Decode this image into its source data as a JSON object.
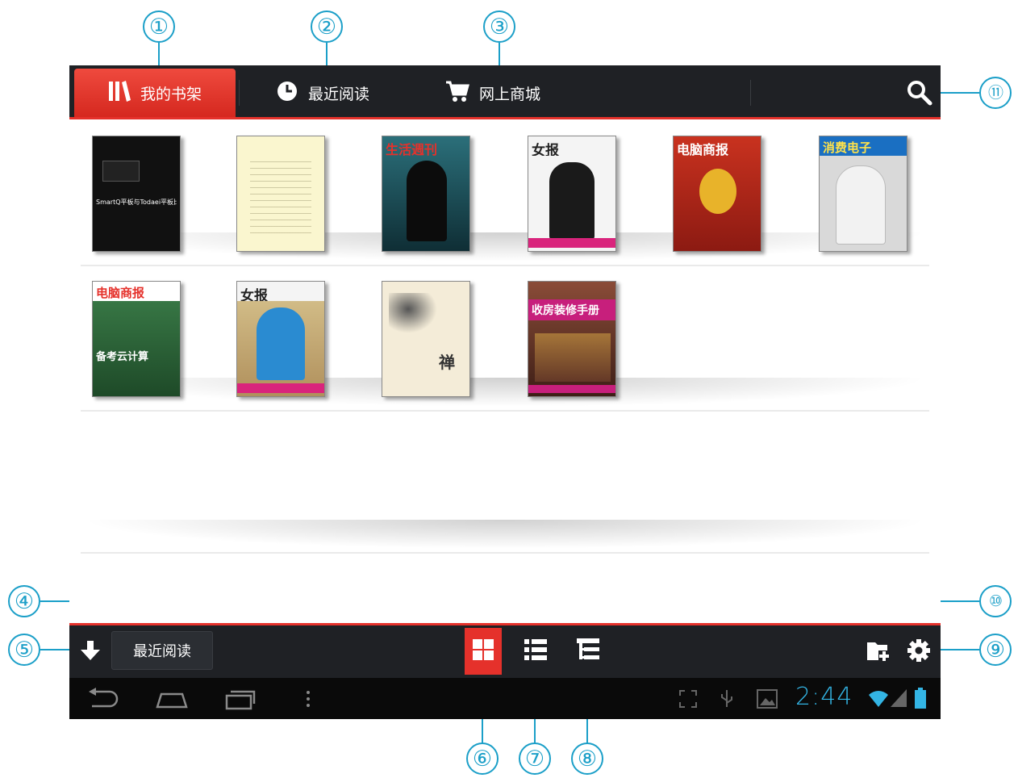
{
  "tabs": [
    {
      "label": "我的书架",
      "icon": "bookshelf-icon",
      "active": true
    },
    {
      "label": "最近阅读",
      "icon": "clock-icon",
      "active": false
    },
    {
      "label": "网上商城",
      "icon": "cart-icon",
      "active": false
    }
  ],
  "callouts": [
    "①",
    "②",
    "③",
    "④",
    "⑤",
    "⑥",
    "⑦",
    "⑧",
    "⑨",
    "⑩",
    "⑪"
  ],
  "shelf_row1": [
    {
      "cover_title": "SmartQ平板与Todaei平板比较",
      "bg": "#111111",
      "accent": "#e5312b"
    },
    {
      "cover_title": "",
      "bg": "#faf6cf",
      "accent": "#999999"
    },
    {
      "cover_title": "生活週刊",
      "bg": "#1f5560",
      "accent": "#e5312b"
    },
    {
      "cover_title": "女报",
      "bg": "#f4f4f4",
      "accent": "#222222"
    },
    {
      "cover_title": "电脑商报",
      "bg": "#b3261e",
      "accent": "#e8b32a"
    },
    {
      "cover_title": "消费电子",
      "bg": "#d9d9d9",
      "accent": "#1a6fc2"
    }
  ],
  "shelf_row2": [
    {
      "cover_title": "电脑商报",
      "bg": "#2e6b3b",
      "accent": "#e5312b",
      "sub": "备考云计算"
    },
    {
      "cover_title": "女报",
      "bg": "#c9b27d",
      "accent": "#2a8bd1"
    },
    {
      "cover_title": "禅",
      "bg": "#f4ecd8",
      "accent": "#555555"
    },
    {
      "cover_title": "收房装修手册",
      "bg": "#6a3a2e",
      "accent": "#c71f7c"
    }
  ],
  "bottombar": {
    "recent_label": "最近阅读",
    "icons": {
      "download": "download-icon",
      "grid": "grid-view-icon",
      "list": "list-view-icon",
      "tree": "tree-view-icon",
      "add_folder": "add-folder-icon",
      "settings": "gear-icon"
    }
  },
  "status": {
    "time": "2:44"
  },
  "colors": {
    "accent": "#e5312b",
    "bar": "#1f2125",
    "callout": "#1b9fc8",
    "clock": "#33b5e5"
  }
}
